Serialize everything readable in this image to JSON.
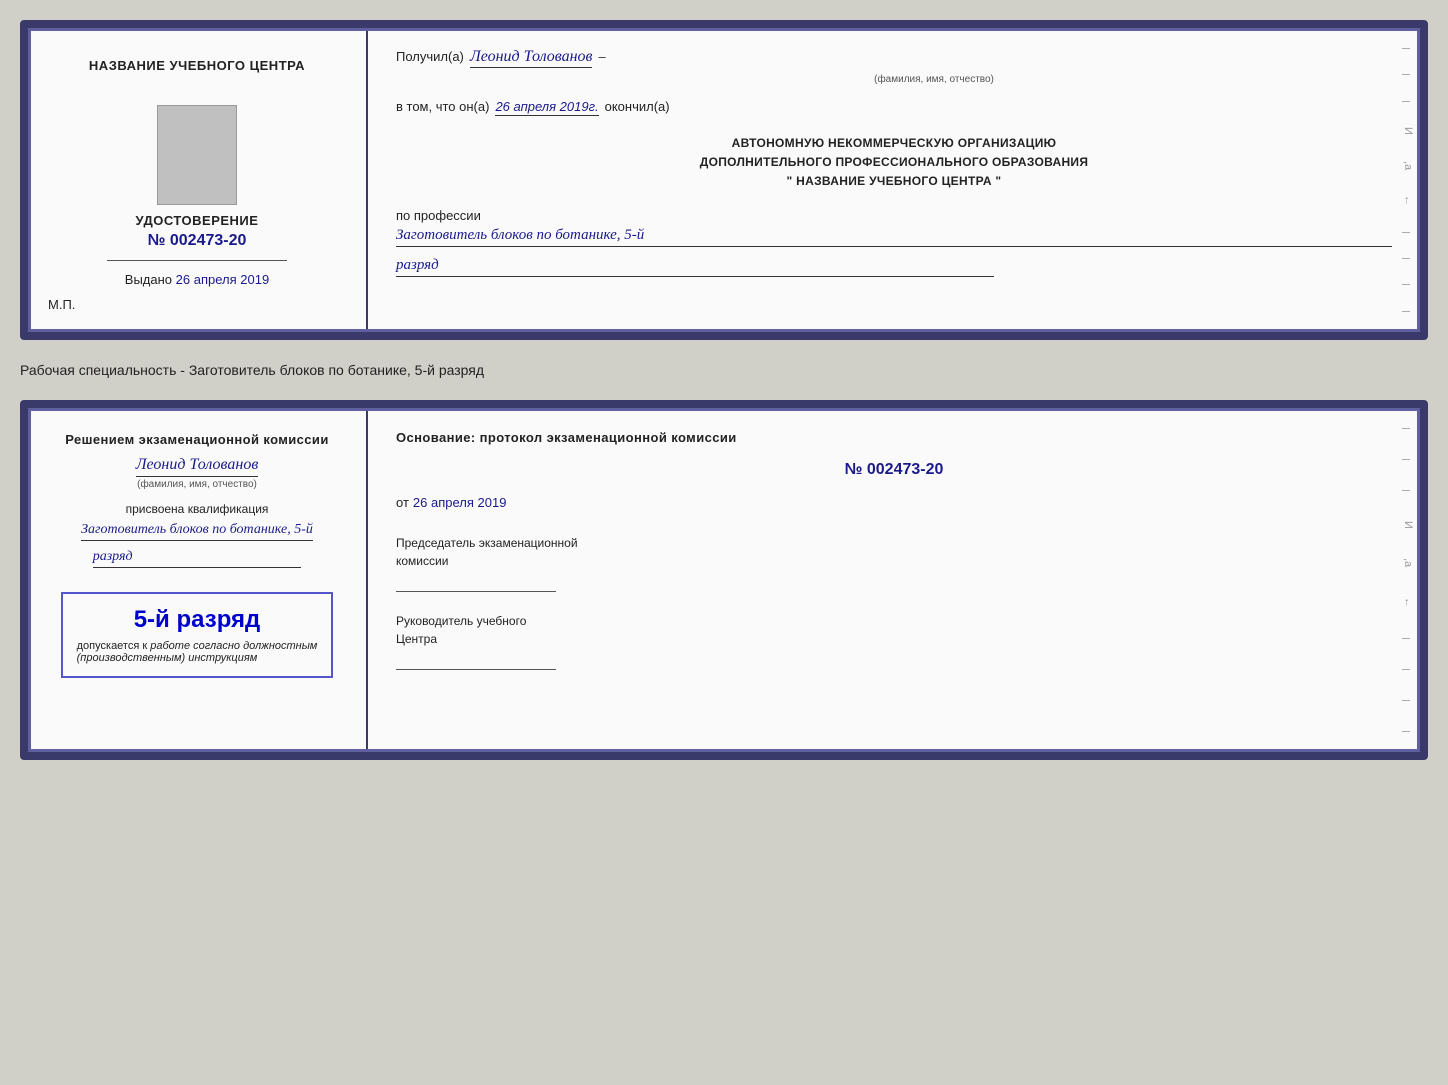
{
  "page": {
    "background": "#d0cfc8"
  },
  "specialty_line": {
    "text": "Рабочая специальность - Заготовитель блоков по ботанике, 5-й разряд"
  },
  "doc1": {
    "left": {
      "title": "НАЗВАНИЕ УЧЕБНОГО ЦЕНТРА",
      "cert_label": "УДОСТОВЕРЕНИЕ",
      "cert_number": "№ 002473-20",
      "issued_label": "Выдано",
      "issued_value": "26 апреля 2019",
      "mp_label": "М.П."
    },
    "right": {
      "recipient_label": "Получил(а)",
      "recipient_name": "Леонид Толованов",
      "fio_sub": "(фамилия, имя, отчество)",
      "completed_label": "в том, что он(а)",
      "completed_date": "26 апреля 2019г.",
      "completed_suffix": "окончил(а)",
      "org_line1": "АВТОНОМНУЮ НЕКОММЕРЧЕСКУЮ ОРГАНИЗАЦИЮ",
      "org_line2": "ДОПОЛНИТЕЛЬНОГО ПРОФЕССИОНАЛЬНОГО ОБРАЗОВАНИЯ",
      "org_line3": "\"  НАЗВАНИЕ УЧЕБНОГО ЦЕНТРА  \"",
      "profession_label": "по профессии",
      "profession_value": "Заготовитель блоков по ботанике, 5-й",
      "rank_value": "разряд",
      "dash": "–"
    }
  },
  "doc2": {
    "left": {
      "decision_text": "Решением экзаменационной комиссии",
      "person_name": "Леонид Толованов",
      "fio_sub": "(фамилия, имя, отчество)",
      "assigned_label": "присвоена квалификация",
      "profession_value": "Заготовитель блоков по ботанике, 5-й",
      "rank_value": "разряд",
      "stamp_rank": "5-й разряд",
      "stamp_allowed": "допускается к",
      "stamp_work": "работе согласно должностным",
      "stamp_instructions": "(производственным) инструкциям"
    },
    "right": {
      "basis_label": "Основание: протокол экзаменационной комиссии",
      "protocol_number": "№  002473-20",
      "date_prefix": "от",
      "date_value": "26 апреля 2019",
      "chair_label": "Председатель экзаменационной",
      "chair_label2": "комиссии",
      "director_label": "Руководитель учебного",
      "director_label2": "Центра",
      "dash": "–"
    }
  }
}
